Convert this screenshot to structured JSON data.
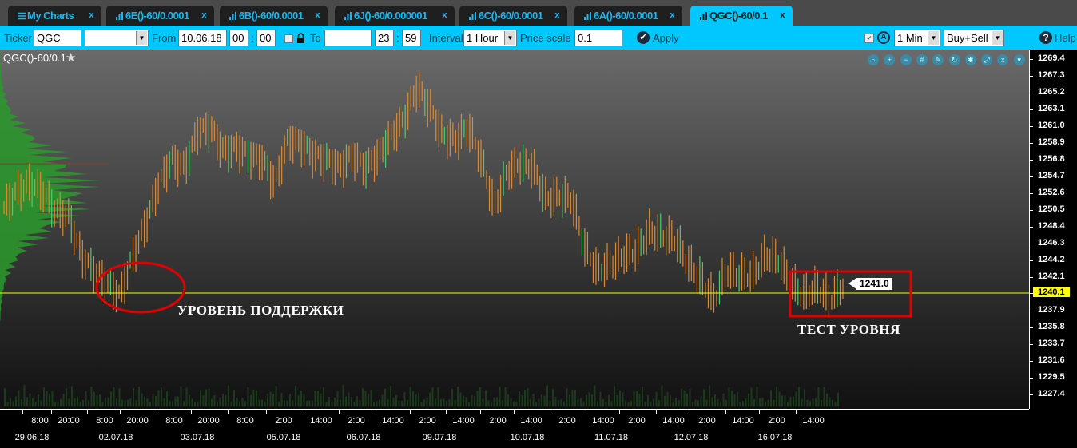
{
  "tabs": [
    {
      "label": "My Charts",
      "icon": "menu-icon"
    },
    {
      "label": "6E()-60/0.0001",
      "icon": "bar-chart-icon"
    },
    {
      "label": "6B()-60/0.0001",
      "icon": "bar-chart-icon"
    },
    {
      "label": "6J()-60/0.000001",
      "icon": "bar-chart-icon"
    },
    {
      "label": "6C()-60/0.0001",
      "icon": "bar-chart-icon"
    },
    {
      "label": "6A()-60/0.0001",
      "icon": "bar-chart-icon"
    },
    {
      "label": "QGC()-60/0.1",
      "icon": "bar-chart-icon",
      "active": true
    }
  ],
  "close_glyph": "x",
  "toolbar": {
    "ticker_label": "Ticker",
    "ticker_value": "QGC",
    "ticker_select": "",
    "from_label": "From",
    "from_date": "10.06.18",
    "from_h": "00",
    "from_m": "00",
    "sep": ":",
    "to_label": "To",
    "to_date": "",
    "to_h": "23",
    "to_m": "59",
    "interval_label": "Interval",
    "interval_value": "1 Hour",
    "price_scale_label": "Price scale",
    "price_scale_value": "0.1",
    "apply_label": "Apply",
    "period_value": "1 Min",
    "side_value": "Buy+Sell",
    "help_label": "Help",
    "auto_glyph": "A"
  },
  "chart": {
    "title": "QGC()-60/0.1",
    "star": "★",
    "price_labels": [
      "1269.4",
      "1267.3",
      "1265.2",
      "1263.1",
      "1261.0",
      "1258.9",
      "1256.8",
      "1254.7",
      "1252.6",
      "1250.5",
      "1248.4",
      "1246.3",
      "1244.2",
      "1242.1",
      "1240.1",
      "1237.9",
      "1235.8",
      "1233.7",
      "1231.6",
      "1229.5",
      "1227.4"
    ],
    "current_price": "1240.1",
    "last_price_label": "1241.0",
    "time_labels": [
      "8:00",
      "20:00",
      "8:00",
      "20:00",
      "8:00",
      "20:00",
      "8:00",
      "2:00",
      "14:00",
      "2:00",
      "14:00",
      "2:00",
      "14:00",
      "2:00",
      "14:00",
      "2:00",
      "14:00",
      "2:00",
      "14:00",
      "2:00",
      "14:00",
      "2:00",
      "14:00"
    ],
    "date_labels": [
      "29.06.18",
      "02.07.18",
      "03.07.18",
      "05.07.18",
      "06.07.18",
      "09.07.18",
      "10.07.18",
      "11.07.18",
      "12.07.18",
      "16.07.18"
    ],
    "annotation_support": "УРОВЕНЬ ПОДДЕРЖКИ",
    "annotation_test": "ТЕСТ УРОВНЯ",
    "colors": {
      "bar": "#e08a30",
      "bar_alt": "#4ad06a",
      "level_line": "#ffff00",
      "annotation": "#e00000",
      "accent": "#00c8ff"
    },
    "approx_prices": [
      1250.8,
      1252.8,
      1253.8,
      1252.8,
      1250.3,
      1249.8,
      1244.8,
      1242.8,
      1241.3,
      1239.8,
      1244.8,
      1248.8,
      1253.8,
      1256.8,
      1255.8,
      1260.3,
      1260.8,
      1257.8,
      1258.3,
      1257.3,
      1256.8,
      1253.8,
      1259.3,
      1258.8,
      1257.3,
      1256.8,
      1255.8,
      1257.3,
      1255.8,
      1257.3,
      1259.8,
      1261.8,
      1265.8,
      1263.3,
      1259.8,
      1259.3,
      1260.8,
      1256.8,
      1250.8,
      1255.3,
      1256.3,
      1255.8,
      1251.8,
      1252.3,
      1251.8,
      1245.8,
      1242.8,
      1243.8,
      1244.8,
      1245.3,
      1247.8,
      1247.3,
      1246.8,
      1243.8,
      1241.8,
      1239.3,
      1242.8,
      1242.3,
      1242.3,
      1244.8,
      1244.3,
      1241.3,
      1239.8,
      1240.8,
      1239.3,
      1241.0
    ]
  }
}
